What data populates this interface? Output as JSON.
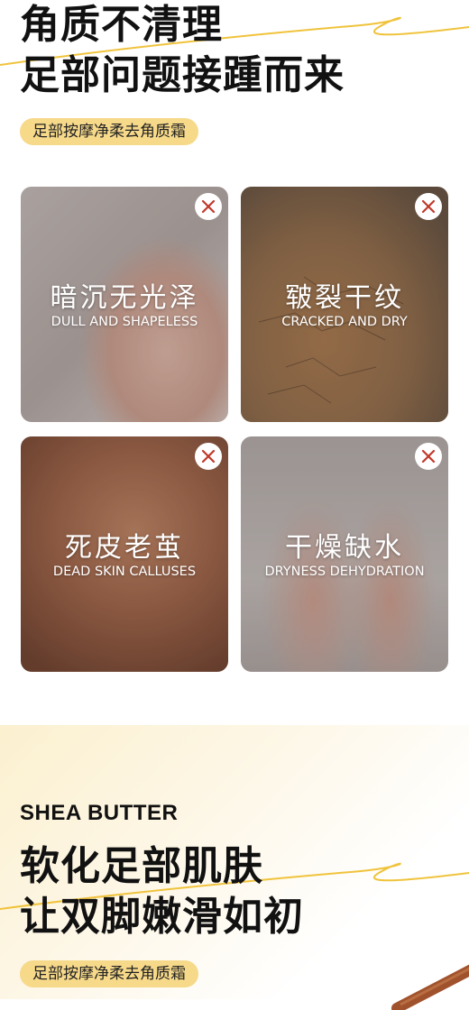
{
  "section1": {
    "headline_line1": "角质不清理",
    "headline_line2": "足部问题接踵而来",
    "tag": "足部按摩净柔去角质霜"
  },
  "cards": [
    {
      "title_cn": "暗沉无光泽",
      "title_en": "DULL AND SHAPELESS",
      "icon": "close-x-icon"
    },
    {
      "title_cn": "皲裂干纹",
      "title_en": "CRACKED AND DRY",
      "icon": "close-x-icon"
    },
    {
      "title_cn": "死皮老茧",
      "title_en": "DEAD SKIN CALLUSES",
      "icon": "close-x-icon"
    },
    {
      "title_cn": "干燥缺水",
      "title_en": "DRYNESS DEHYDRATION",
      "icon": "close-x-icon"
    }
  ],
  "section2": {
    "label_en": "SHEA BUTTER",
    "headline_line1": "软化足部肌肤",
    "headline_line2": "让双脚嫩滑如初",
    "tag": "足部按摩净柔去角质霜"
  },
  "colors": {
    "accent_gold": "#f0c33c",
    "pill_bg": "#f7d98a",
    "icon_red": "#c0392b"
  }
}
